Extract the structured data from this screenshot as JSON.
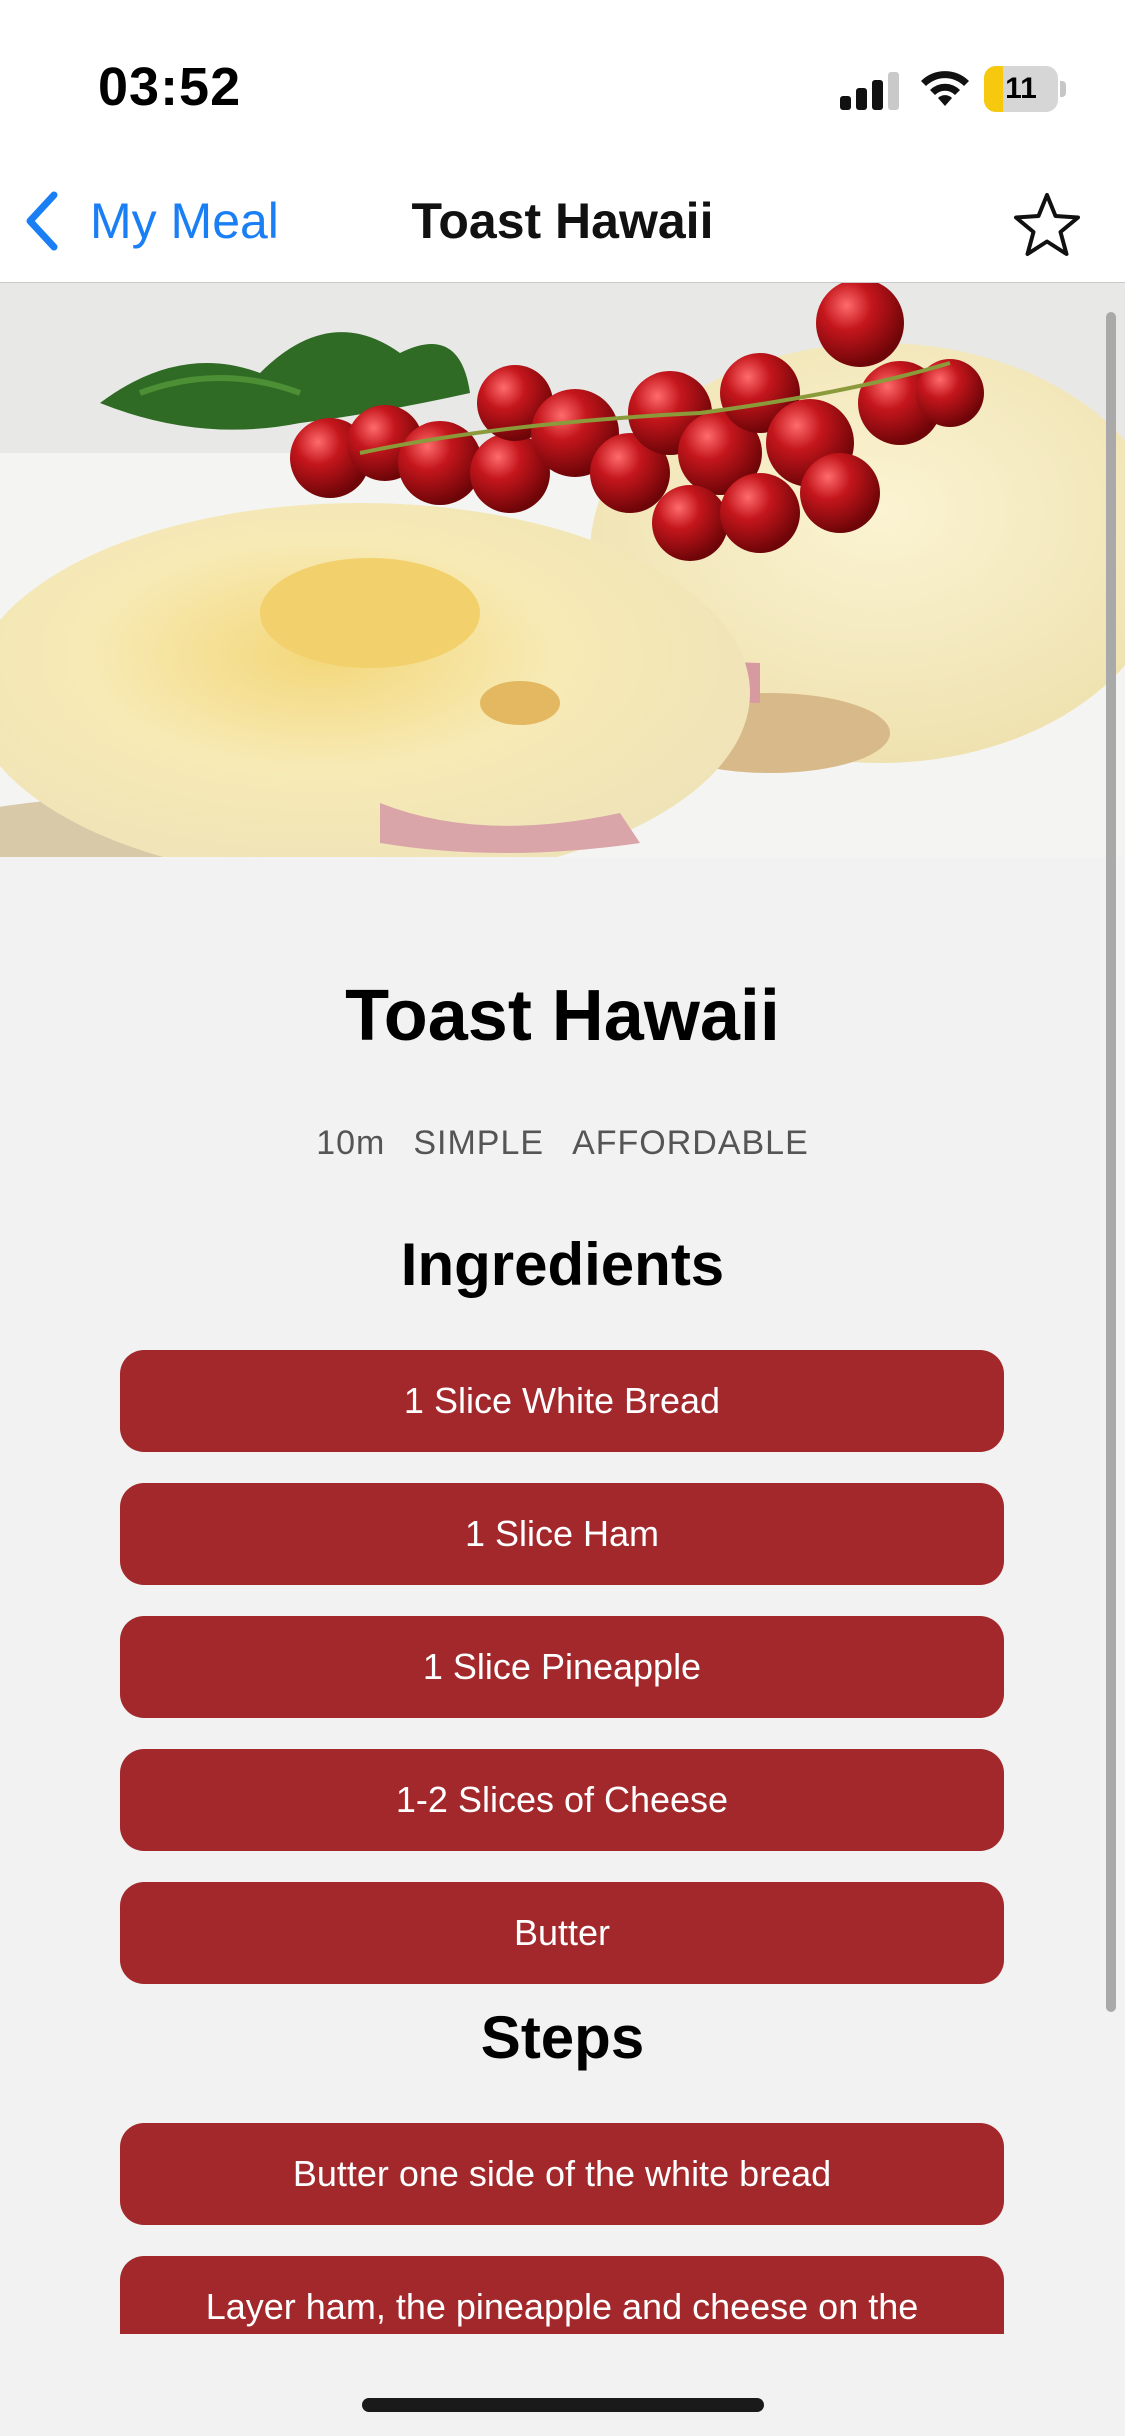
{
  "status_bar": {
    "time": "03:52",
    "battery_level": "11"
  },
  "nav": {
    "back_label": "My Meal",
    "title": "Toast Hawaii"
  },
  "colors": {
    "accent": "#1a7ff5",
    "pill": "#a3282b",
    "background": "#f2f2f2",
    "battery": "#f6c90e"
  },
  "icons": {
    "back": "chevron-left-icon",
    "favorite": "star-outline-icon",
    "battery": "battery-charging-icon"
  },
  "meal": {
    "title": "Toast Hawaii",
    "duration": "10m",
    "complexity": "SIMPLE",
    "affordability": "AFFORDABLE"
  },
  "ingredients_title": "Ingredients",
  "ingredients": [
    "1 Slice White Bread",
    "1 Slice Ham",
    "1 Slice Pineapple",
    "1-2 Slices of Cheese",
    "Butter"
  ],
  "steps_title": "Steps",
  "steps": [
    "Butter one side of the white bread",
    "Layer ham, the pineapple and cheese on the"
  ]
}
